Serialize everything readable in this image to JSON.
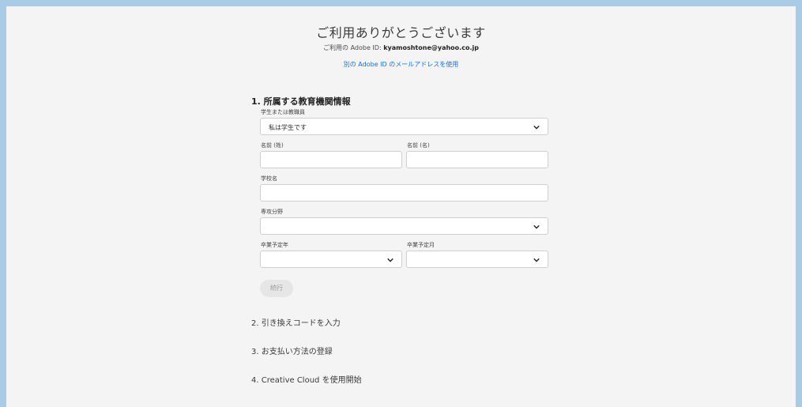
{
  "header": {
    "title": "ご利用ありがとうございます",
    "adobe_id_label": "ご利用の Adobe ID:",
    "adobe_id_email": "kyamoshtone@yahoo.co.jp",
    "alt_link": "別の Adobe ID のメールアドレスを使用"
  },
  "section1": {
    "title": "1. 所属する教育機関情報",
    "role": {
      "label": "学生または教職員",
      "value": "私は学生です"
    },
    "last_name": {
      "label": "名前 (姓)",
      "value": ""
    },
    "first_name": {
      "label": "名前 (名)",
      "value": ""
    },
    "school": {
      "label": "学校名",
      "value": ""
    },
    "major": {
      "label": "専攻分野",
      "value": ""
    },
    "grad_year": {
      "label": "卒業予定年",
      "value": ""
    },
    "grad_month": {
      "label": "卒業予定月",
      "value": ""
    },
    "continue_label": "続行"
  },
  "steps": [
    {
      "label": "2. 引き換えコードを入力"
    },
    {
      "label": "3. お支払い方法の登録"
    },
    {
      "label": "4. Creative Cloud を使用開始"
    }
  ],
  "colors": {
    "link": "#1473e6",
    "frame": "#a9cbe6",
    "panel": "#f4f4f4"
  },
  "icons": {
    "dropdown": "chevron-down-icon"
  }
}
